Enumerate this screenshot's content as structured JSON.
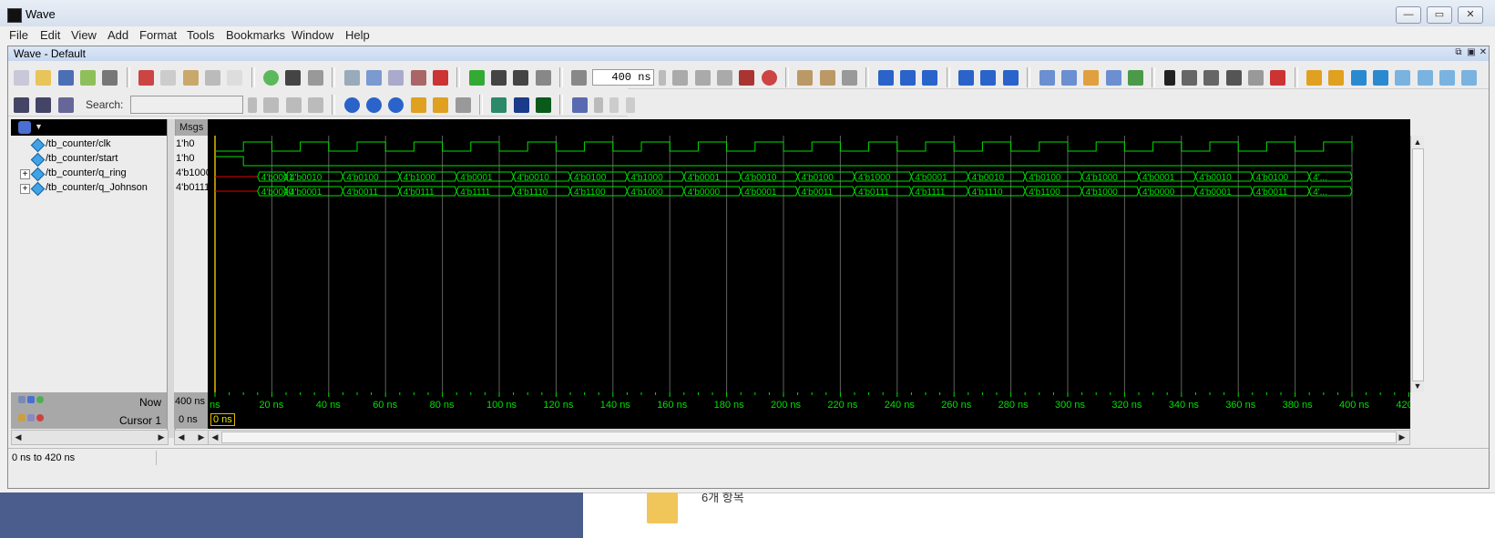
{
  "app": {
    "title": "Wave"
  },
  "window_controls": {
    "minimize": "—",
    "maximize": "▭",
    "close": "✕"
  },
  "menu": [
    "File",
    "Edit",
    "View",
    "Add",
    "Format",
    "Tools",
    "Bookmarks",
    "Window",
    "Help"
  ],
  "subwindow": {
    "title": "Wave - Default"
  },
  "toolbar": {
    "time_value": "400 ns",
    "search_label": "Search:",
    "search_placeholder": ""
  },
  "panes": {
    "msgs_header": "Msgs"
  },
  "signals": [
    {
      "name": "/tb_counter/clk",
      "value": "1'h0",
      "expandable": false
    },
    {
      "name": "/tb_counter/start",
      "value": "1'h0",
      "expandable": false
    },
    {
      "name": "/tb_counter/q_ring",
      "value": "4'b1000",
      "expandable": true
    },
    {
      "name": "/tb_counter/q_Johnson",
      "value": "4'b0111",
      "expandable": true
    }
  ],
  "bottom": {
    "now_label": "Now",
    "now_value": "400 ns",
    "cursor_label": "Cursor 1",
    "cursor_value": "0 ns",
    "cursor_tag": "0 ns"
  },
  "timeline_labels": [
    "ns",
    "20 ns",
    "40 ns",
    "60 ns",
    "80 ns",
    "100 ns",
    "120 ns",
    "140 ns",
    "160 ns",
    "180 ns",
    "200 ns",
    "220 ns",
    "240 ns",
    "260 ns",
    "280 ns",
    "300 ns",
    "320 ns",
    "340 ns",
    "360 ns",
    "380 ns",
    "400 ns",
    "420"
  ],
  "waveform": {
    "clk_period_ns": 20,
    "start_high_ns": [
      0,
      10
    ],
    "q_ring_values": [
      "4'b0001",
      "4'b0010",
      "4'b0100",
      "4'b1000",
      "4'b0001",
      "4'b0010",
      "4'b0100",
      "4'b1000",
      "4'b0001",
      "4'b0010",
      "4'b0100",
      "4'b1000",
      "4'b0001",
      "4'b0010",
      "4'b0100",
      "4'b1000",
      "4'b0001",
      "4'b0010",
      "4'b0100",
      "4'..."
    ],
    "q_johnson_values": [
      "4'b0000",
      "4'b0001",
      "4'b0011",
      "4'b0111",
      "4'b1111",
      "4'b1110",
      "4'b1100",
      "4'b1000",
      "4'b0000",
      "4'b0001",
      "4'b0011",
      "4'b0111",
      "4'b1111",
      "4'b1110",
      "4'b1100",
      "4'b1000",
      "4'b0000",
      "4'b0001",
      "4'b0011",
      "4'..."
    ],
    "colors": {
      "signal": "#00e000",
      "undefined": "#e00000",
      "cursor": "#e6b800",
      "grid": "#606060"
    }
  },
  "status": {
    "range": "0 ns to 420 ns"
  },
  "desktop": {
    "folder_caption": "6개 항목"
  }
}
